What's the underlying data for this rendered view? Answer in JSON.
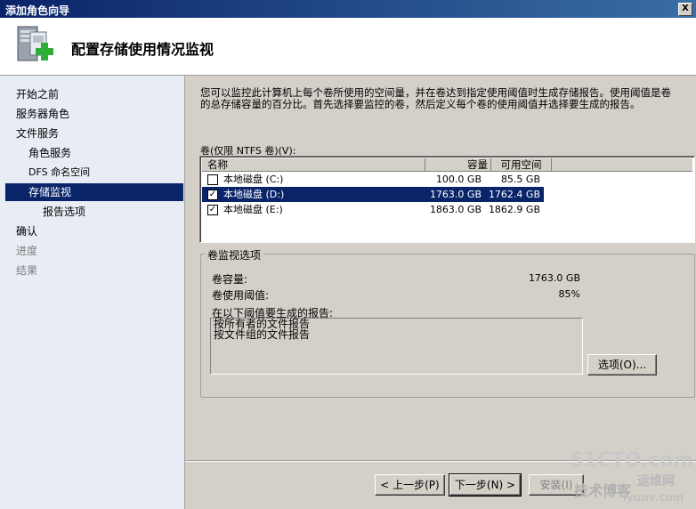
{
  "window": {
    "title": "添加角色向导",
    "close_label": "X"
  },
  "header": {
    "title": "配置存储使用情况监视"
  },
  "nav": {
    "items": [
      {
        "label": "开始之前",
        "state": "normal"
      },
      {
        "label": "服务器角色",
        "state": "normal"
      },
      {
        "label": "文件服务",
        "state": "normal"
      },
      {
        "label": "角色服务",
        "state": "normal"
      },
      {
        "label": "DFS 命名空间",
        "state": "normal"
      },
      {
        "label": "存储监视",
        "state": "selected"
      },
      {
        "label": "报告选项",
        "state": "normal"
      },
      {
        "label": "确认",
        "state": "normal"
      },
      {
        "label": "进度",
        "state": "disabled"
      },
      {
        "label": "结果",
        "state": "disabled"
      }
    ]
  },
  "main": {
    "description": "您可以监控此计算机上每个卷所使用的空间量，并在卷达到指定使用阈值时生成存储报告。使用阈值是卷的总存储容量的百分比。首先选择要监控的卷，然后定义每个卷的使用阈值并选择要生成的报告。",
    "volumes_label": "卷(仅限 NTFS 卷)(V):",
    "columns": {
      "name": "名称",
      "capacity": "容量",
      "free": "可用空间"
    },
    "volumes": [
      {
        "name": "本地磁盘 (C:)",
        "capacity": "100.0 GB",
        "free": "85.5 GB",
        "checked": false,
        "selected": false
      },
      {
        "name": "本地磁盘 (D:)",
        "capacity": "1763.0 GB",
        "free": "1762.4 GB",
        "checked": true,
        "selected": true
      },
      {
        "name": "本地磁盘 (E:)",
        "capacity": "1863.0 GB",
        "free": "1862.9 GB",
        "checked": true,
        "selected": false
      }
    ],
    "options": {
      "group_title": "卷监视选项",
      "capacity_label": "卷容量:",
      "capacity_value": "1763.0 GB",
      "threshold_label": "卷使用阈值:",
      "threshold_value": "85%",
      "reports_label": "在以下阈值要生成的报告:",
      "reports": [
        "按所有者的文件报告",
        "按文件组的文件报告"
      ],
      "options_button": "选项(O)..."
    }
  },
  "footer": {
    "back_label": "< 上一步(P)",
    "next_label": "下一步(N) >",
    "install_label": "安装(I)"
  },
  "watermark": {
    "line1": "51CTO.com",
    "line2": "技术博客",
    "line3": "运维网",
    "line4": "iyunv.com"
  }
}
